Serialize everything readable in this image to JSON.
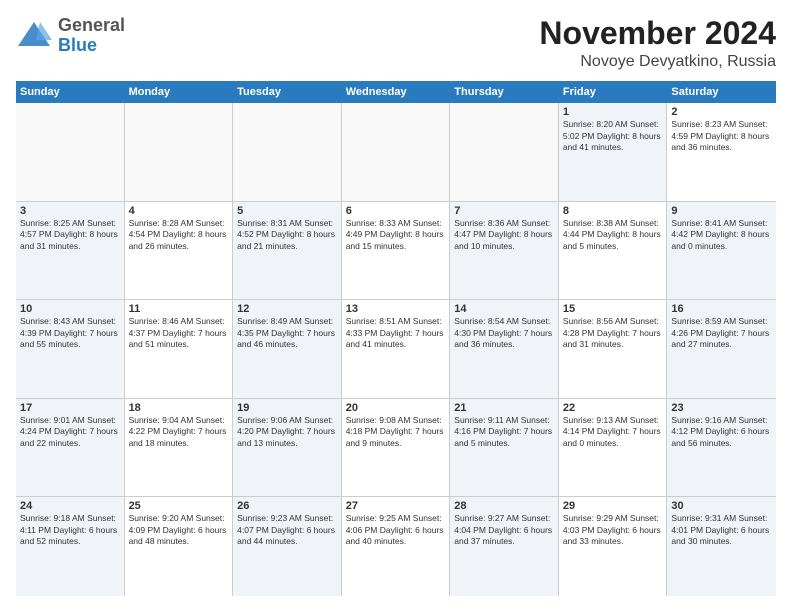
{
  "header": {
    "logo_line1": "General",
    "logo_line2": "Blue",
    "month_title": "November 2024",
    "location": "Novoye Devyatkino, Russia"
  },
  "calendar": {
    "days_of_week": [
      "Sunday",
      "Monday",
      "Tuesday",
      "Wednesday",
      "Thursday",
      "Friday",
      "Saturday"
    ],
    "weeks": [
      {
        "cells": [
          {
            "day": "",
            "info": "",
            "empty": true
          },
          {
            "day": "",
            "info": "",
            "empty": true
          },
          {
            "day": "",
            "info": "",
            "empty": true
          },
          {
            "day": "",
            "info": "",
            "empty": true
          },
          {
            "day": "",
            "info": "",
            "empty": true
          },
          {
            "day": "1",
            "info": "Sunrise: 8:20 AM\nSunset: 5:02 PM\nDaylight: 8 hours\nand 41 minutes.",
            "shaded": true
          },
          {
            "day": "2",
            "info": "Sunrise: 8:23 AM\nSunset: 4:59 PM\nDaylight: 8 hours\nand 36 minutes.",
            "shaded": false
          }
        ]
      },
      {
        "cells": [
          {
            "day": "3",
            "info": "Sunrise: 8:25 AM\nSunset: 4:57 PM\nDaylight: 8 hours\nand 31 minutes.",
            "shaded": true
          },
          {
            "day": "4",
            "info": "Sunrise: 8:28 AM\nSunset: 4:54 PM\nDaylight: 8 hours\nand 26 minutes.",
            "shaded": false
          },
          {
            "day": "5",
            "info": "Sunrise: 8:31 AM\nSunset: 4:52 PM\nDaylight: 8 hours\nand 21 minutes.",
            "shaded": true
          },
          {
            "day": "6",
            "info": "Sunrise: 8:33 AM\nSunset: 4:49 PM\nDaylight: 8 hours\nand 15 minutes.",
            "shaded": false
          },
          {
            "day": "7",
            "info": "Sunrise: 8:36 AM\nSunset: 4:47 PM\nDaylight: 8 hours\nand 10 minutes.",
            "shaded": true
          },
          {
            "day": "8",
            "info": "Sunrise: 8:38 AM\nSunset: 4:44 PM\nDaylight: 8 hours\nand 5 minutes.",
            "shaded": false
          },
          {
            "day": "9",
            "info": "Sunrise: 8:41 AM\nSunset: 4:42 PM\nDaylight: 8 hours\nand 0 minutes.",
            "shaded": true
          }
        ]
      },
      {
        "cells": [
          {
            "day": "10",
            "info": "Sunrise: 8:43 AM\nSunset: 4:39 PM\nDaylight: 7 hours\nand 55 minutes.",
            "shaded": true
          },
          {
            "day": "11",
            "info": "Sunrise: 8:46 AM\nSunset: 4:37 PM\nDaylight: 7 hours\nand 51 minutes.",
            "shaded": false
          },
          {
            "day": "12",
            "info": "Sunrise: 8:49 AM\nSunset: 4:35 PM\nDaylight: 7 hours\nand 46 minutes.",
            "shaded": true
          },
          {
            "day": "13",
            "info": "Sunrise: 8:51 AM\nSunset: 4:33 PM\nDaylight: 7 hours\nand 41 minutes.",
            "shaded": false
          },
          {
            "day": "14",
            "info": "Sunrise: 8:54 AM\nSunset: 4:30 PM\nDaylight: 7 hours\nand 36 minutes.",
            "shaded": true
          },
          {
            "day": "15",
            "info": "Sunrise: 8:56 AM\nSunset: 4:28 PM\nDaylight: 7 hours\nand 31 minutes.",
            "shaded": false
          },
          {
            "day": "16",
            "info": "Sunrise: 8:59 AM\nSunset: 4:26 PM\nDaylight: 7 hours\nand 27 minutes.",
            "shaded": true
          }
        ]
      },
      {
        "cells": [
          {
            "day": "17",
            "info": "Sunrise: 9:01 AM\nSunset: 4:24 PM\nDaylight: 7 hours\nand 22 minutes.",
            "shaded": true
          },
          {
            "day": "18",
            "info": "Sunrise: 9:04 AM\nSunset: 4:22 PM\nDaylight: 7 hours\nand 18 minutes.",
            "shaded": false
          },
          {
            "day": "19",
            "info": "Sunrise: 9:06 AM\nSunset: 4:20 PM\nDaylight: 7 hours\nand 13 minutes.",
            "shaded": true
          },
          {
            "day": "20",
            "info": "Sunrise: 9:08 AM\nSunset: 4:18 PM\nDaylight: 7 hours\nand 9 minutes.",
            "shaded": false
          },
          {
            "day": "21",
            "info": "Sunrise: 9:11 AM\nSunset: 4:16 PM\nDaylight: 7 hours\nand 5 minutes.",
            "shaded": true
          },
          {
            "day": "22",
            "info": "Sunrise: 9:13 AM\nSunset: 4:14 PM\nDaylight: 7 hours\nand 0 minutes.",
            "shaded": false
          },
          {
            "day": "23",
            "info": "Sunrise: 9:16 AM\nSunset: 4:12 PM\nDaylight: 6 hours\nand 56 minutes.",
            "shaded": true
          }
        ]
      },
      {
        "cells": [
          {
            "day": "24",
            "info": "Sunrise: 9:18 AM\nSunset: 4:11 PM\nDaylight: 6 hours\nand 52 minutes.",
            "shaded": true
          },
          {
            "day": "25",
            "info": "Sunrise: 9:20 AM\nSunset: 4:09 PM\nDaylight: 6 hours\nand 48 minutes.",
            "shaded": false
          },
          {
            "day": "26",
            "info": "Sunrise: 9:23 AM\nSunset: 4:07 PM\nDaylight: 6 hours\nand 44 minutes.",
            "shaded": true
          },
          {
            "day": "27",
            "info": "Sunrise: 9:25 AM\nSunset: 4:06 PM\nDaylight: 6 hours\nand 40 minutes.",
            "shaded": false
          },
          {
            "day": "28",
            "info": "Sunrise: 9:27 AM\nSunset: 4:04 PM\nDaylight: 6 hours\nand 37 minutes.",
            "shaded": true
          },
          {
            "day": "29",
            "info": "Sunrise: 9:29 AM\nSunset: 4:03 PM\nDaylight: 6 hours\nand 33 minutes.",
            "shaded": false
          },
          {
            "day": "30",
            "info": "Sunrise: 9:31 AM\nSunset: 4:01 PM\nDaylight: 6 hours\nand 30 minutes.",
            "shaded": true
          }
        ]
      }
    ]
  }
}
